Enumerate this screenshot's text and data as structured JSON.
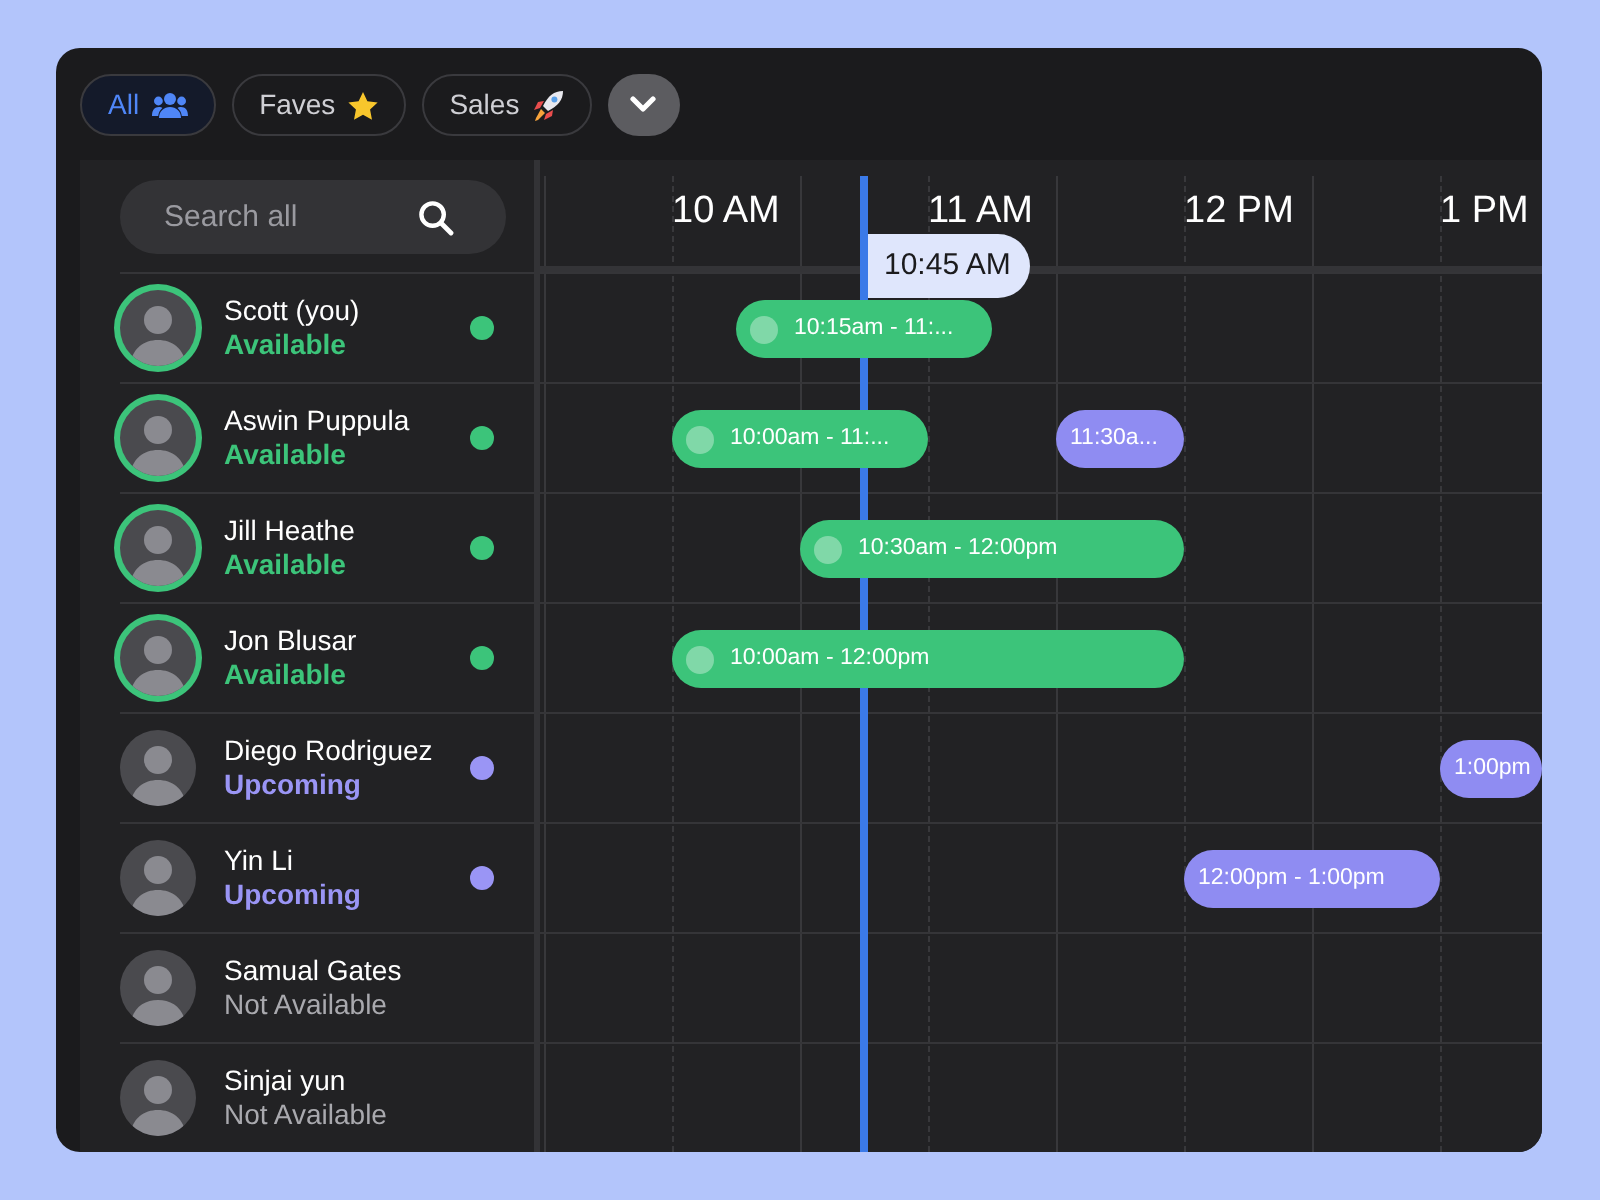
{
  "filters": [
    {
      "label": "All",
      "selected": true
    },
    {
      "label": "Faves",
      "selected": false
    },
    {
      "label": "Sales",
      "selected": false
    }
  ],
  "search": {
    "placeholder": "Search all"
  },
  "hours": [
    "10 AM",
    "11 AM",
    "12 PM",
    "1 PM"
  ],
  "now": {
    "label": "10:45 AM"
  },
  "people": [
    {
      "name": "Scott (you)",
      "status": "Available",
      "kind": "available",
      "events": [
        {
          "label": "10:15am - 11:...",
          "kind": "available"
        }
      ]
    },
    {
      "name": "Aswin Puppula",
      "status": "Available",
      "kind": "available",
      "events": [
        {
          "label": "10:00am - 11:...",
          "kind": "available"
        },
        {
          "label": "11:30a...",
          "kind": "upcoming"
        }
      ]
    },
    {
      "name": "Jill Heathe",
      "status": "Available",
      "kind": "available",
      "events": [
        {
          "label": "10:30am - 12:00pm",
          "kind": "available"
        }
      ]
    },
    {
      "name": "Jon Blusar",
      "status": "Available",
      "kind": "available",
      "events": [
        {
          "label": "10:00am - 12:00pm",
          "kind": "available"
        }
      ]
    },
    {
      "name": "Diego Rodriguez",
      "status": "Upcoming",
      "kind": "upcoming",
      "events": [
        {
          "label": "1:00pm",
          "kind": "upcoming"
        }
      ]
    },
    {
      "name": "Yin Li",
      "status": "Upcoming",
      "kind": "upcoming",
      "events": [
        {
          "label": "12:00pm - 1:00pm",
          "kind": "upcoming"
        }
      ]
    },
    {
      "name": "Samual Gates",
      "status": "Not Available",
      "kind": "unavailable"
    },
    {
      "name": "Sinjai yun",
      "status": "Not Available",
      "kind": "unavailable"
    }
  ]
}
